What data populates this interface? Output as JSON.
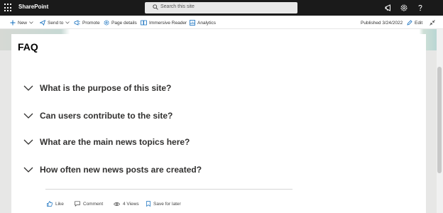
{
  "suite_bar": {
    "app_name": "SharePoint",
    "search_placeholder": "Search this site"
  },
  "command_bar": {
    "new_label": "New",
    "send_to_label": "Send to",
    "promote_label": "Promote",
    "page_details_label": "Page details",
    "immersive_reader_label": "Immersive Reader",
    "analytics_label": "Analytics",
    "published_label": "Published 3/24/2022",
    "edit_label": "Edit"
  },
  "page": {
    "title": "FAQ",
    "faq": [
      {
        "question": "What is the purpose of this site?"
      },
      {
        "question": "Can users contribute to the site?"
      },
      {
        "question": "What are the main news topics here?"
      },
      {
        "question": "How often new news posts are created?"
      }
    ]
  },
  "social_bar": {
    "like_label": "Like",
    "comment_label": "Comment",
    "views_label": "4 Views",
    "save_label": "Save for later"
  },
  "colors": {
    "suite_bar": "#1a1a1a",
    "page_bg": "#ffffff",
    "canvas_bg": "#e7e7e6",
    "text": "#323130",
    "accent": "#0f6cbd"
  },
  "icons": [
    "waffle-icon",
    "search-icon",
    "megaphone-icon",
    "gear-icon",
    "help-icon",
    "plus-icon",
    "send-icon",
    "promote-icon",
    "page-details-icon",
    "immersive-reader-icon",
    "analytics-icon",
    "pencil-icon",
    "collapse-icon",
    "chevron-down-icon",
    "like-icon",
    "comment-icon",
    "eye-icon",
    "bookmark-icon"
  ]
}
